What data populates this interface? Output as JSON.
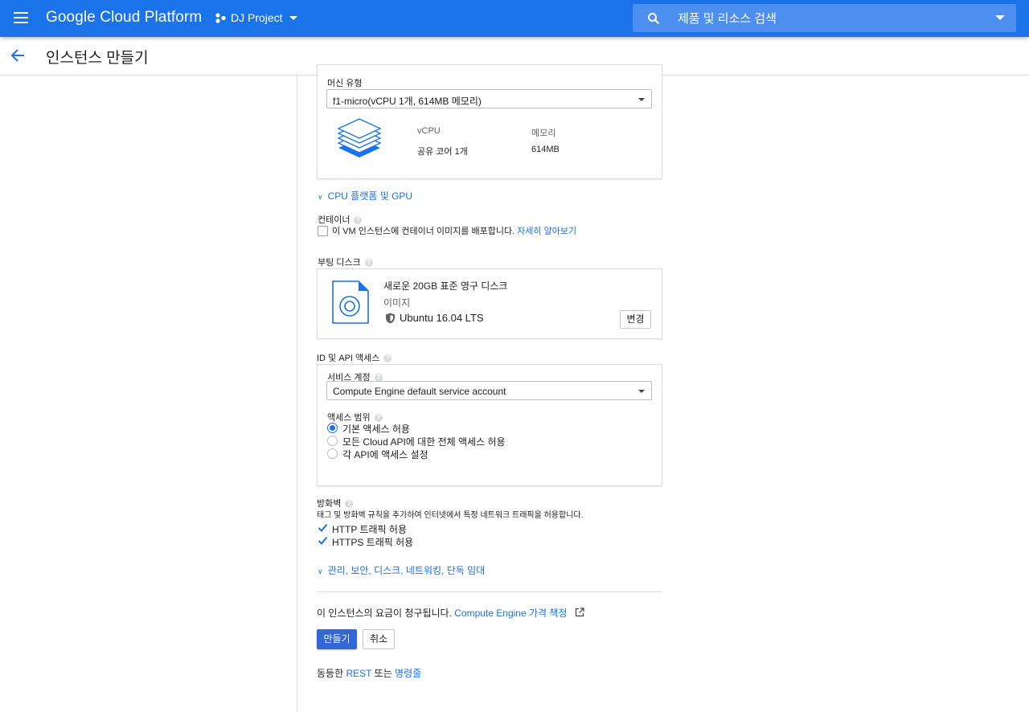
{
  "topbar": {
    "brand": "Google Cloud Platform",
    "project": "DJ Project",
    "search_placeholder": "제품 및 리소스 검색"
  },
  "page": {
    "title": "인스턴스 만들기"
  },
  "machine": {
    "label": "머신 유형",
    "selected": "f1-micro(vCPU 1개, 614MB 메모리)",
    "vcpu_header": "vCPU",
    "memory_header": "메모리",
    "vcpu_value": "공유 코어 1개",
    "memory_value": "614MB"
  },
  "cpu_platform_link": "CPU 플랫폼 및 GPU",
  "container": {
    "label": "컨테이너",
    "checkbox_text": "이 VM 인스턴스에 컨테이너 이미지를 배포합니다.",
    "learn_more": "자세히 알아보기"
  },
  "boot_disk": {
    "label": "부팅 디스크",
    "title": "새로운 20GB 표준 영구 디스크",
    "image_label": "이미지",
    "image_name": "Ubuntu 16.04 LTS",
    "change_button": "변경"
  },
  "identity": {
    "label": "ID 및 API 액세스",
    "service_account_label": "서비스 계정",
    "service_account_value": "Compute Engine default service account",
    "scope_label": "액세스 범위",
    "scopes": [
      "기본 액세스 허용",
      "모든 Cloud API에 대한 전체 액세스 허용",
      "각 API에 액세스 설정"
    ],
    "scope_selected_index": 0
  },
  "firewall": {
    "label": "방화벽",
    "description": "태그 및 방화벽 규칙을 추가하여 인터넷에서 특정 네트워크 트래픽을 허용합니다.",
    "http": "HTTP 트래픽 허용",
    "https": "HTTPS 트래픽 허용",
    "http_checked": true,
    "https_checked": true
  },
  "advanced_link": "관리, 보안, 디스크, 네트워킹, 단독 임대",
  "billing": {
    "text": "이 인스턴스의 요금이 청구됩니다.",
    "pricing_link": "Compute Engine 가격 책정"
  },
  "actions": {
    "create": "만들기",
    "cancel": "취소"
  },
  "equivalent": {
    "prefix": "동등한",
    "rest": "REST",
    "middle": "또는",
    "cli": "명령줄"
  },
  "colors": {
    "brand_blue": "#1a73e8",
    "primary_button": "#3367d6"
  }
}
